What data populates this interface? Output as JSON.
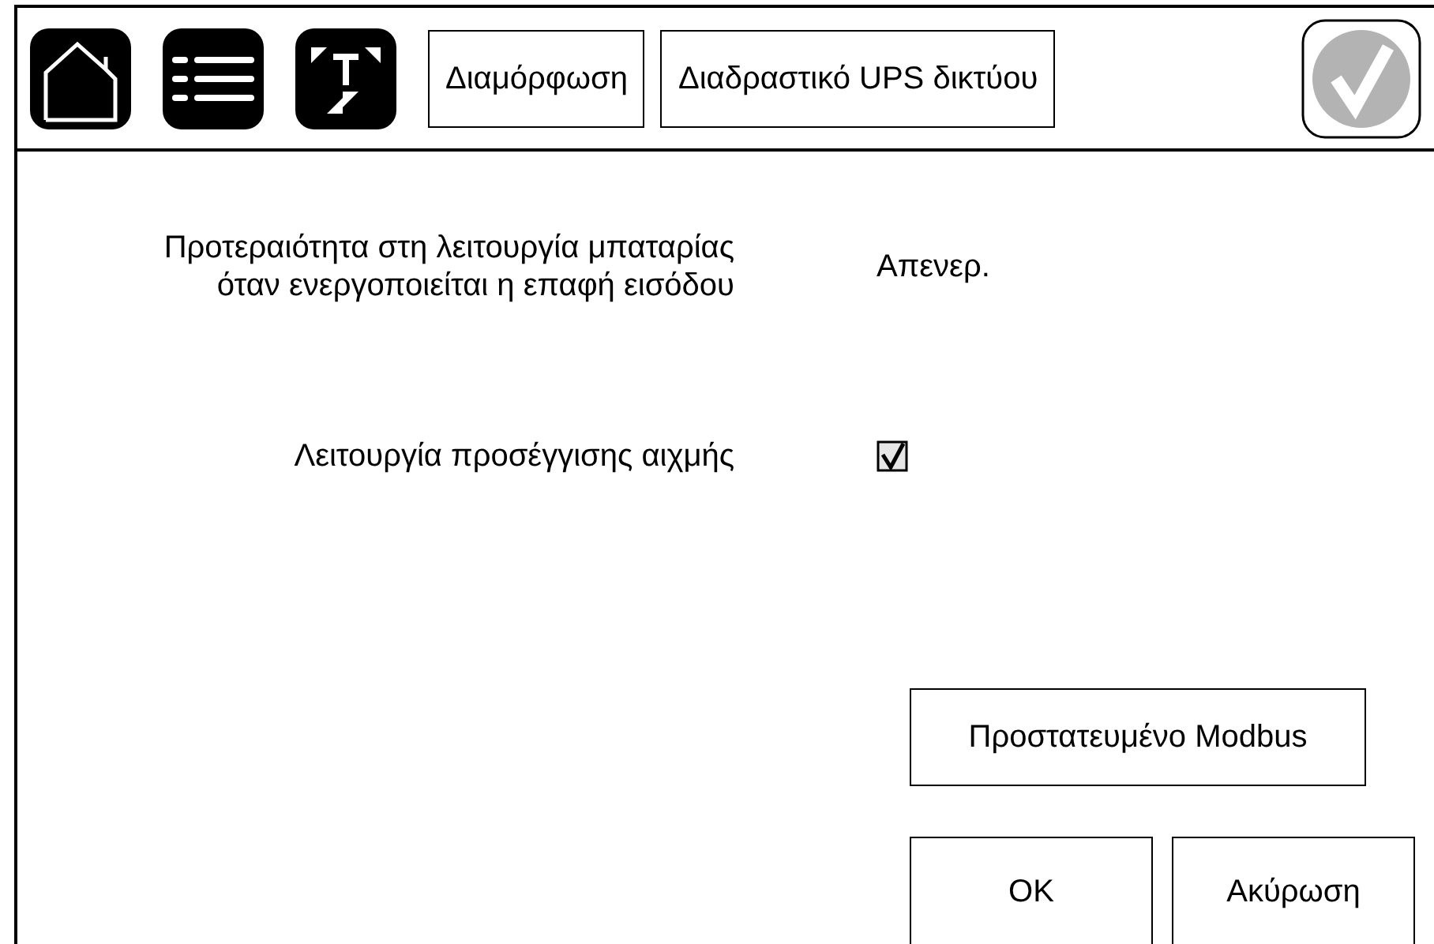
{
  "breadcrumbs": [
    "Διαμόρφωση",
    "Διαδραστικό UPS δικτύου"
  ],
  "settings": [
    {
      "kind": "value",
      "label": "Προτεραιότητα στη λειτουργία μπαταρίας όταν ενεργοποιείται η επαφή εισόδου",
      "value": "Απενερ."
    },
    {
      "kind": "checkbox",
      "label": "Λειτουργία προσέγγισης αιχμής",
      "checked": true
    }
  ],
  "modbus_button": "Προστατευμένο Modbus",
  "buttons": [
    "OK",
    "Ακύρωση"
  ]
}
